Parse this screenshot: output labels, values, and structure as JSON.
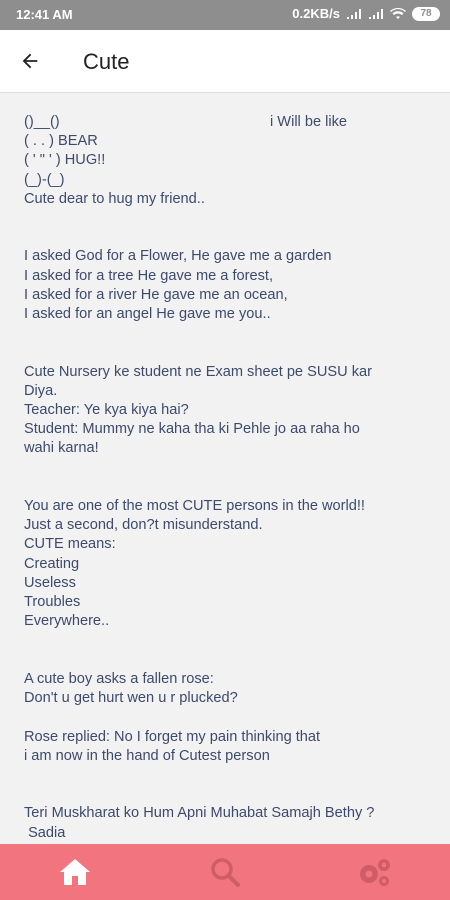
{
  "status_bar": {
    "time": "12:41 AM",
    "speed": "0.2KB/s",
    "battery": "78"
  },
  "app_bar": {
    "title": "Cute",
    "back_icon": "arrow-left-icon"
  },
  "content": {
    "aside": "i Will be like",
    "body": "()__()\n( . . ) BEAR\n( ' \" ' ) HUG!!\n(_)-(_)\nCute dear to hug my friend..\n\n\nI asked God for a Flower, He gave me a garden\nI asked for a tree He gave me a forest,\nI asked for a river He gave me an ocean,\nI asked for an angel He gave me you..\n\n\nCute Nursery ke student ne Exam sheet pe SUSU kar\nDiya.\nTeacher: Ye kya kiya hai?\nStudent: Mummy ne kaha tha ki Pehle jo aa raha ho\nwahi karna!\n\n\nYou are one of the most CUTE persons in the world!!\nJust a second, don?t misunderstand.\nCUTE means:\nCreating\nUseless\nTroubles\nEverywhere..\n\n\nA cute boy asks a fallen rose:\nDon't u get hurt wen u r plucked?\n\nRose replied: No I forget my pain thinking that\ni am now in the hand of Cutest person\n\n\nTeri Muskharat ko Hum Apni Muhabat Samajh Bethy ?\n Sadia\nTera Muskrana Kheen Teri Adat Tw Nahi"
  },
  "bottom_nav": {
    "items": [
      {
        "icon": "home-icon"
      },
      {
        "icon": "search-icon"
      },
      {
        "icon": "gears-icon"
      }
    ],
    "color": "#f2747f"
  }
}
